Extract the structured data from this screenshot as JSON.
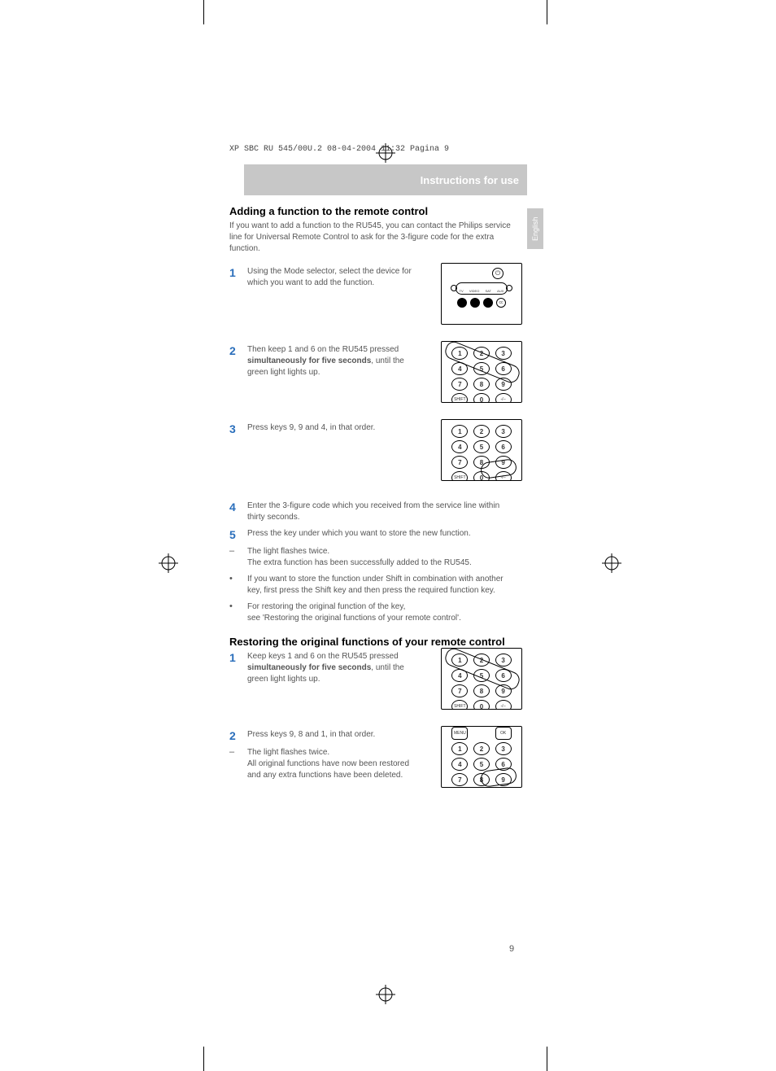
{
  "header_line": "XP SBC RU 545/00U.2  08-04-2004  11:32  Pagina 9",
  "banner": "Instructions for use",
  "lang": "English",
  "page_number": "9",
  "section1": {
    "title": "Adding a function to the remote control",
    "intro": "If you want to add a function to the RU545, you can contact the Philips service line for Universal Remote Control to ask for the 3-figure code for the extra function.",
    "steps": {
      "s1_num": "1",
      "s1_text": "Using the Mode selector, select the device for which you want to add the function.",
      "s2_num": "2",
      "s2_text_a": "Then keep 1 and 6 on the RU545 pressed ",
      "s2_text_bold": "simultaneously for five seconds",
      "s2_text_b": ", until the green light lights up.",
      "s3_num": "3",
      "s3_text": "Press keys 9, 9 and 4, in that order.",
      "s4_num": "4",
      "s4_text": "Enter the 3-figure code which you received from the service line within thirty seconds.",
      "s5_num": "5",
      "s5_text": "Press the key under which you want to store the new function.",
      "d1_text": "The light flashes twice.",
      "d1_text2": "The extra function has been successfully added to the RU545.",
      "b1_text": "If you want to store the function under Shift in combination with another key, first press the Shift key and then press the required function key.",
      "b2_text_a": "For restoring the original function of the key,",
      "b2_text_b": "see 'Restoring the original functions of your remote control'."
    }
  },
  "section2": {
    "title": "Restoring the original functions of your remote control",
    "steps": {
      "s1_num": "1",
      "s1_text_a": "Keep keys 1 and 6 on the RU545 pressed ",
      "s1_text_bold": "simultaneously for five seconds",
      "s1_text_b": ", until the green light lights up.",
      "s2_num": "2",
      "s2_text": "Press keys 9, 8 and 1, in that order.",
      "d1_text": "The light flashes twice.",
      "d1_text2": "All original functions have now been restored and any extra functions have been deleted."
    }
  },
  "keys": {
    "k1": "1",
    "k2": "2",
    "k3": "3",
    "k4": "4",
    "k5": "5",
    "k6": "6",
    "k7": "7",
    "k8": "8",
    "k9": "9",
    "shift": "SHIFT",
    "k0": "0",
    "dash": "-/--",
    "menu": "MENU",
    "ok": "OK",
    "tv": "TV",
    "video": "VIDEO",
    "sat": "SAT",
    "aux": "AUX",
    "cc": "cc"
  }
}
